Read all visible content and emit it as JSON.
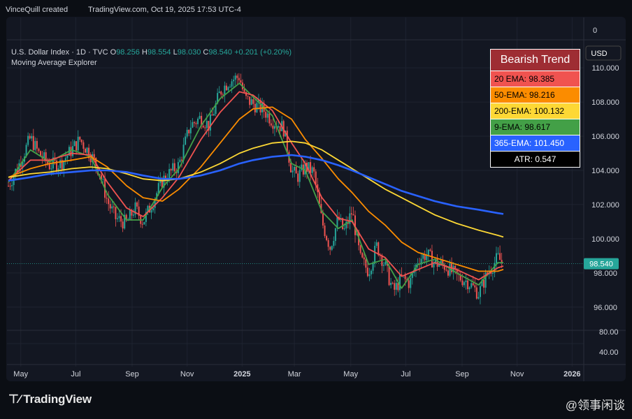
{
  "topbar": {
    "author": "VinceQuill created",
    "source": "TradingView.com, Oct 19, 2025 17:53 UTC-4"
  },
  "header": {
    "symbol": "U.S. Dollar Index · 1D · TVC",
    "o_label": "O",
    "o_val": "98.256",
    "h_label": "H",
    "h_val": "98.554",
    "l_label": "L",
    "l_val": "98.030",
    "c_label": "C",
    "c_val": "98.540",
    "change": "+0.201 (+0.20%)",
    "indicator": "Moving Average Explorer"
  },
  "legend": {
    "title": "Bearish Trend",
    "rows": [
      {
        "label": "20 EMA: 98.385",
        "color": "#f05350"
      },
      {
        "label": "50-EMA: 98.216",
        "color": "#fb8c00"
      },
      {
        "label": "200-EMA: 100.132",
        "color": "#fdd835"
      },
      {
        "label": "9-EMA: 98.617",
        "color": "#43a047"
      },
      {
        "label": "365-EMA: 101.450",
        "color": "#2962ff"
      }
    ],
    "atr": "ATR: 0.547"
  },
  "footer": {
    "brand": "TradingView",
    "watermark": "@领事闲谈"
  },
  "chart_data": {
    "type": "line",
    "currency": "USD",
    "last_price_label": "98.540",
    "y_ticks": [
      "110.000",
      "108.000",
      "106.000",
      "104.000",
      "102.000",
      "100.000",
      "98.000",
      "96.000"
    ],
    "lower_pane_ticks": [
      "0",
      "80.00",
      "40.00"
    ],
    "ylim": [
      95.5,
      111.6
    ],
    "x_ticks": [
      {
        "label": "May",
        "t": 0.45
      },
      {
        "label": "Jul",
        "t": 2.45
      },
      {
        "label": "Sep",
        "t": 4.5
      },
      {
        "label": "Nov",
        "t": 6.5
      },
      {
        "label": "2025",
        "t": 8.5
      },
      {
        "label": "Mar",
        "t": 10.4
      },
      {
        "label": "May",
        "t": 12.45
      },
      {
        "label": "Jul",
        "t": 14.45
      },
      {
        "label": "Sep",
        "t": 16.5
      },
      {
        "label": "Nov",
        "t": 18.5
      },
      {
        "label": "2026",
        "t": 20.5
      }
    ],
    "price_path": {
      "t": [
        0,
        0.4,
        0.8,
        1.1,
        1.5,
        1.9,
        2.3,
        2.6,
        3.0,
        3.3,
        3.6,
        3.9,
        4.3,
        4.6,
        4.9,
        5.2,
        5.6,
        5.9,
        6.2,
        6.6,
        7.0,
        7.3,
        7.7,
        8.0,
        8.4,
        8.6,
        8.9,
        9.3,
        9.6,
        10.0,
        10.3,
        10.5,
        10.8,
        11.1,
        11.4,
        11.7,
        12.0,
        12.2,
        12.5,
        12.8,
        13.1,
        13.4,
        13.7,
        14.0,
        14.3,
        14.6,
        14.9,
        15.2,
        15.5,
        15.9,
        16.3,
        16.7,
        17.1,
        17.4,
        17.8,
        18.0
      ],
      "close": [
        103.1,
        104.4,
        105.9,
        105.0,
        104.3,
        104.4,
        105.2,
        105.8,
        104.9,
        104.0,
        102.2,
        101.2,
        100.9,
        101.8,
        101.0,
        102.0,
        103.4,
        103.9,
        104.3,
        106.6,
        107.1,
        106.6,
        108.6,
        109.2,
        109.5,
        108.2,
        107.9,
        107.5,
        106.9,
        106.5,
        104.0,
        103.6,
        104.2,
        103.9,
        101.0,
        99.5,
        101.2,
        100.4,
        101.6,
        98.8,
        98.1,
        99.6,
        98.4,
        96.9,
        97.7,
        97.4,
        98.8,
        99.1,
        98.6,
        98.4,
        97.8,
        97.5,
        96.8,
        97.9,
        98.9,
        98.5
      ]
    },
    "series": [
      {
        "name": "9-EMA",
        "color": "#43a047",
        "t": [
          0,
          0.8,
          1.5,
          2.3,
          3.0,
          3.6,
          4.3,
          4.9,
          5.6,
          6.2,
          7.0,
          7.7,
          8.4,
          8.9,
          9.6,
          10.3,
          10.8,
          11.4,
          12.0,
          12.5,
          13.1,
          13.7,
          14.3,
          14.9,
          15.5,
          16.3,
          17.1,
          17.8,
          18.0
        ],
        "v": [
          103.3,
          105.2,
          104.5,
          105.2,
          104.8,
          102.6,
          101.1,
          101.1,
          103.0,
          104.1,
          106.6,
          108.2,
          109.1,
          108.3,
          107.2,
          104.4,
          104.0,
          101.6,
          100.6,
          101.1,
          98.5,
          98.8,
          97.1,
          98.5,
          98.8,
          98.0,
          97.3,
          98.6,
          98.6
        ]
      },
      {
        "name": "20 EMA",
        "color": "#f05350",
        "t": [
          0,
          0.8,
          1.5,
          2.3,
          3.0,
          3.6,
          4.3,
          4.9,
          5.6,
          6.2,
          7.0,
          7.7,
          8.4,
          8.9,
          9.6,
          10.3,
          10.8,
          11.4,
          12.0,
          12.5,
          13.1,
          13.7,
          14.3,
          14.9,
          15.5,
          16.3,
          17.1,
          17.8,
          18.0
        ],
        "v": [
          103.4,
          104.6,
          104.6,
          105.0,
          104.9,
          103.3,
          101.8,
          101.3,
          102.4,
          103.6,
          105.8,
          107.4,
          108.6,
          108.4,
          107.5,
          105.6,
          104.4,
          102.4,
          101.2,
          101.0,
          99.4,
          98.9,
          97.8,
          98.2,
          98.6,
          98.2,
          97.6,
          98.3,
          98.4
        ]
      },
      {
        "name": "50-EMA",
        "color": "#fb8c00",
        "t": [
          0,
          0.8,
          1.5,
          2.3,
          3.0,
          3.6,
          4.3,
          4.9,
          5.6,
          6.2,
          7.0,
          7.7,
          8.4,
          8.9,
          9.6,
          10.3,
          10.8,
          11.4,
          12.0,
          12.5,
          13.1,
          13.7,
          14.3,
          14.9,
          15.5,
          16.3,
          17.1,
          17.8,
          18.0
        ],
        "v": [
          103.6,
          104.1,
          104.4,
          104.6,
          104.8,
          104.2,
          103.1,
          102.4,
          102.2,
          102.9,
          104.2,
          105.6,
          107.0,
          107.6,
          107.7,
          107.0,
          105.8,
          104.7,
          103.5,
          102.7,
          101.6,
          100.8,
          99.8,
          99.2,
          98.9,
          98.5,
          98.1,
          98.1,
          98.2
        ]
      },
      {
        "name": "200-EMA",
        "color": "#fdd835",
        "t": [
          0,
          0.8,
          1.5,
          2.3,
          3.0,
          3.6,
          4.3,
          4.9,
          5.6,
          6.2,
          7.0,
          7.7,
          8.4,
          8.9,
          9.6,
          10.3,
          10.8,
          11.4,
          12.0,
          12.5,
          13.1,
          13.7,
          14.3,
          14.9,
          15.5,
          16.3,
          17.1,
          17.8,
          18.0
        ],
        "v": [
          103.6,
          103.8,
          103.9,
          104.1,
          104.2,
          104.1,
          103.8,
          103.5,
          103.4,
          103.5,
          103.9,
          104.4,
          105.0,
          105.3,
          105.6,
          105.7,
          105.6,
          105.2,
          104.6,
          104.1,
          103.5,
          102.9,
          102.4,
          101.9,
          101.4,
          100.9,
          100.5,
          100.2,
          100.1
        ]
      },
      {
        "name": "365-EMA",
        "color": "#2962ff",
        "t": [
          0,
          0.8,
          1.5,
          2.3,
          3.0,
          3.6,
          4.3,
          4.9,
          5.6,
          6.2,
          7.0,
          7.7,
          8.4,
          8.9,
          9.6,
          10.3,
          10.8,
          11.4,
          12.0,
          12.5,
          13.1,
          13.7,
          14.3,
          14.9,
          15.5,
          16.3,
          17.1,
          17.8,
          18.0
        ],
        "v": [
          103.4,
          103.6,
          103.8,
          103.9,
          104.0,
          104.0,
          103.9,
          103.7,
          103.5,
          103.5,
          103.7,
          104.0,
          104.4,
          104.6,
          104.8,
          104.9,
          104.8,
          104.6,
          104.3,
          104.0,
          103.6,
          103.2,
          102.8,
          102.5,
          102.2,
          101.9,
          101.7,
          101.5,
          101.45
        ]
      }
    ]
  }
}
